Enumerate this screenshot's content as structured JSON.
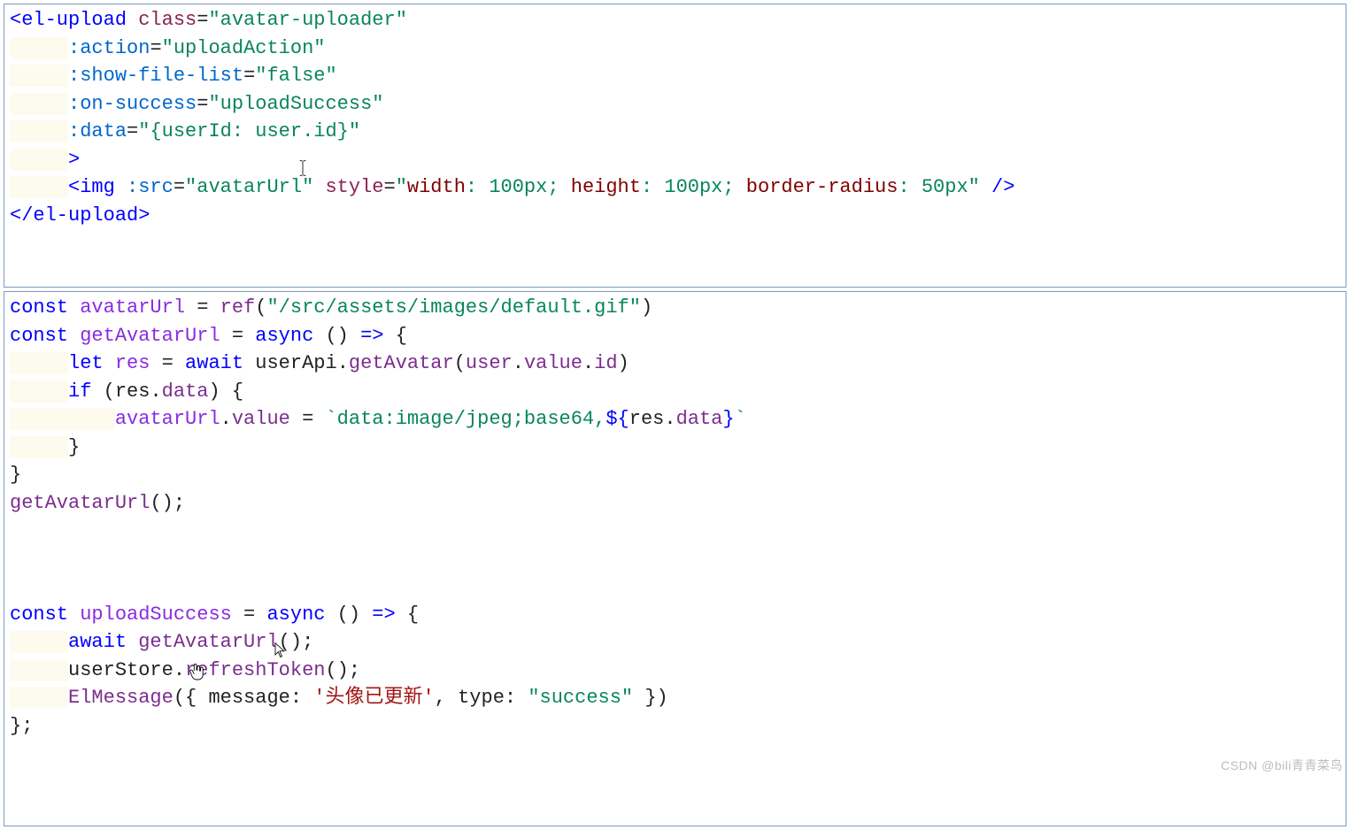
{
  "panel1": {
    "lines": [
      [
        {
          "t": "<",
          "c": "tag"
        },
        {
          "t": "el-upload",
          "c": "tag"
        },
        {
          "t": " ",
          "c": "plain"
        },
        {
          "t": "class",
          "c": "attr"
        },
        {
          "t": "=",
          "c": "punct"
        },
        {
          "t": "\"avatar-uploader\"",
          "c": "strjs"
        }
      ],
      [
        {
          "t": "     ",
          "c": "plain",
          "bg": true
        },
        {
          "t": ":action",
          "c": "attrkey"
        },
        {
          "t": "=",
          "c": "punct"
        },
        {
          "t": "\"uploadAction\"",
          "c": "strjs"
        }
      ],
      [
        {
          "t": "     ",
          "c": "plain",
          "bg": true
        },
        {
          "t": ":show-file-list",
          "c": "attrkey"
        },
        {
          "t": "=",
          "c": "punct"
        },
        {
          "t": "\"false\"",
          "c": "strjs"
        }
      ],
      [
        {
          "t": "     ",
          "c": "plain",
          "bg": true
        },
        {
          "t": ":on-success",
          "c": "attrkey"
        },
        {
          "t": "=",
          "c": "punct"
        },
        {
          "t": "\"uploadSuccess\"",
          "c": "strjs"
        }
      ],
      [
        {
          "t": "     ",
          "c": "plain",
          "bg": true
        },
        {
          "t": ":data",
          "c": "attrkey"
        },
        {
          "t": "=",
          "c": "punct"
        },
        {
          "t": "\"{userId: user.id}\"",
          "c": "strjs"
        }
      ],
      [
        {
          "t": "     ",
          "c": "plain",
          "bg": true
        },
        {
          "t": ">",
          "c": "tag"
        }
      ],
      [
        {
          "t": "     ",
          "c": "plain",
          "bg": true
        },
        {
          "t": "<",
          "c": "tag"
        },
        {
          "t": "img",
          "c": "tag"
        },
        {
          "t": " ",
          "c": "plain"
        },
        {
          "t": ":src",
          "c": "attrkey"
        },
        {
          "t": "=",
          "c": "punct"
        },
        {
          "t": "\"avatarUrl\"",
          "c": "strjs"
        },
        {
          "t": " ",
          "c": "plain"
        },
        {
          "t": "style",
          "c": "attr"
        },
        {
          "t": "=",
          "c": "punct"
        },
        {
          "t": "\"",
          "c": "strjs"
        },
        {
          "t": "width",
          "c": "cnstr"
        },
        {
          "t": ": ",
          "c": "strjs"
        },
        {
          "t": "100px",
          "c": "strjs"
        },
        {
          "t": "; ",
          "c": "strjs"
        },
        {
          "t": "height",
          "c": "cnstr"
        },
        {
          "t": ": ",
          "c": "strjs"
        },
        {
          "t": "100px",
          "c": "strjs"
        },
        {
          "t": "; ",
          "c": "strjs"
        },
        {
          "t": "border-radius",
          "c": "cnstr"
        },
        {
          "t": ": ",
          "c": "strjs"
        },
        {
          "t": "50px",
          "c": "strjs"
        },
        {
          "t": "\"",
          "c": "strjs"
        },
        {
          "t": " />",
          "c": "tag"
        }
      ],
      [
        {
          "t": "</",
          "c": "tag"
        },
        {
          "t": "el-upload",
          "c": "tag"
        },
        {
          "t": ">",
          "c": "tag"
        }
      ]
    ]
  },
  "panel2": {
    "lines": [
      [
        {
          "t": "const",
          "c": "kw"
        },
        {
          "t": " ",
          "c": "plain"
        },
        {
          "t": "avatarUrl",
          "c": "ident"
        },
        {
          "t": " = ",
          "c": "punct"
        },
        {
          "t": "ref",
          "c": "memb"
        },
        {
          "t": "(",
          "c": "punct"
        },
        {
          "t": "\"/src/assets/images/default.gif\"",
          "c": "strjs"
        },
        {
          "t": ")",
          "c": "punct"
        }
      ],
      [
        {
          "t": "const",
          "c": "kw"
        },
        {
          "t": " ",
          "c": "plain"
        },
        {
          "t": "getAvatarUrl",
          "c": "ident"
        },
        {
          "t": " = ",
          "c": "punct"
        },
        {
          "t": "async",
          "c": "kw"
        },
        {
          "t": " () ",
          "c": "punct"
        },
        {
          "t": "=>",
          "c": "kw"
        },
        {
          "t": " {",
          "c": "punct"
        }
      ],
      [
        {
          "t": "     ",
          "c": "plain",
          "bg": true
        },
        {
          "t": "let",
          "c": "kw"
        },
        {
          "t": " ",
          "c": "plain"
        },
        {
          "t": "res",
          "c": "ident"
        },
        {
          "t": " = ",
          "c": "punct"
        },
        {
          "t": "await",
          "c": "kw"
        },
        {
          "t": " ",
          "c": "plain"
        },
        {
          "t": "userApi",
          "c": "plain"
        },
        {
          "t": ".",
          "c": "punct"
        },
        {
          "t": "getAvatar",
          "c": "memb"
        },
        {
          "t": "(",
          "c": "punct"
        },
        {
          "t": "user",
          "c": "memb"
        },
        {
          "t": ".",
          "c": "punct"
        },
        {
          "t": "value",
          "c": "memb"
        },
        {
          "t": ".",
          "c": "punct"
        },
        {
          "t": "id",
          "c": "memb"
        },
        {
          "t": ")",
          "c": "punct"
        }
      ],
      [
        {
          "t": "     ",
          "c": "plain",
          "bg": true
        },
        {
          "t": "if",
          "c": "kw"
        },
        {
          "t": " (",
          "c": "punct"
        },
        {
          "t": "res",
          "c": "plain"
        },
        {
          "t": ".",
          "c": "punct"
        },
        {
          "t": "data",
          "c": "memb"
        },
        {
          "t": ") {",
          "c": "punct"
        }
      ],
      [
        {
          "t": "         ",
          "c": "plain",
          "bg": true
        },
        {
          "t": "avatarUrl",
          "c": "ident"
        },
        {
          "t": ".",
          "c": "punct"
        },
        {
          "t": "value",
          "c": "memb"
        },
        {
          "t": " = ",
          "c": "punct"
        },
        {
          "t": "`data:image/jpeg;base64,",
          "c": "strjs"
        },
        {
          "t": "${",
          "c": "kw"
        },
        {
          "t": "res",
          "c": "plain"
        },
        {
          "t": ".",
          "c": "punct"
        },
        {
          "t": "data",
          "c": "memb"
        },
        {
          "t": "}",
          "c": "kw"
        },
        {
          "t": "`",
          "c": "strjs"
        }
      ],
      [
        {
          "t": "     ",
          "c": "plain",
          "bg": true
        },
        {
          "t": "}",
          "c": "punct"
        }
      ],
      [
        {
          "t": "}",
          "c": "punct"
        }
      ],
      [
        {
          "t": "getAvatarUrl",
          "c": "memb"
        },
        {
          "t": "();",
          "c": "punct"
        }
      ],
      [
        {
          "t": " ",
          "c": "plain"
        }
      ],
      [
        {
          "t": " ",
          "c": "plain"
        }
      ],
      [
        {
          "t": " ",
          "c": "plain"
        }
      ],
      [
        {
          "t": "const",
          "c": "kw"
        },
        {
          "t": " ",
          "c": "plain"
        },
        {
          "t": "uploadSuccess",
          "c": "ident"
        },
        {
          "t": " = ",
          "c": "punct"
        },
        {
          "t": "async",
          "c": "kw"
        },
        {
          "t": " () ",
          "c": "punct"
        },
        {
          "t": "=>",
          "c": "kw"
        },
        {
          "t": " {",
          "c": "punct"
        }
      ],
      [
        {
          "t": "     ",
          "c": "plain",
          "bg": true
        },
        {
          "t": "await",
          "c": "kw"
        },
        {
          "t": " ",
          "c": "plain"
        },
        {
          "t": "getAvatarUrl",
          "c": "memb"
        },
        {
          "t": "();",
          "c": "punct"
        }
      ],
      [
        {
          "t": "     ",
          "c": "plain",
          "bg": true
        },
        {
          "t": "userStore",
          "c": "plain"
        },
        {
          "t": ".",
          "c": "punct"
        },
        {
          "t": "refreshToken",
          "c": "memb"
        },
        {
          "t": "();",
          "c": "punct"
        }
      ],
      [
        {
          "t": "     ",
          "c": "plain",
          "bg": true
        },
        {
          "t": "ElMessage",
          "c": "memb"
        },
        {
          "t": "({ ",
          "c": "punct"
        },
        {
          "t": "message",
          "c": "plain"
        },
        {
          "t": ": ",
          "c": "punct"
        },
        {
          "t": "'头像已更新'",
          "c": "str"
        },
        {
          "t": ", ",
          "c": "punct"
        },
        {
          "t": "type",
          "c": "plain"
        },
        {
          "t": ": ",
          "c": "punct"
        },
        {
          "t": "\"success\"",
          "c": "strjs"
        },
        {
          "t": " })",
          "c": "punct"
        }
      ],
      [
        {
          "t": "};",
          "c": "punct"
        }
      ]
    ]
  },
  "watermark": "CSDN @bili青青菜鸟"
}
